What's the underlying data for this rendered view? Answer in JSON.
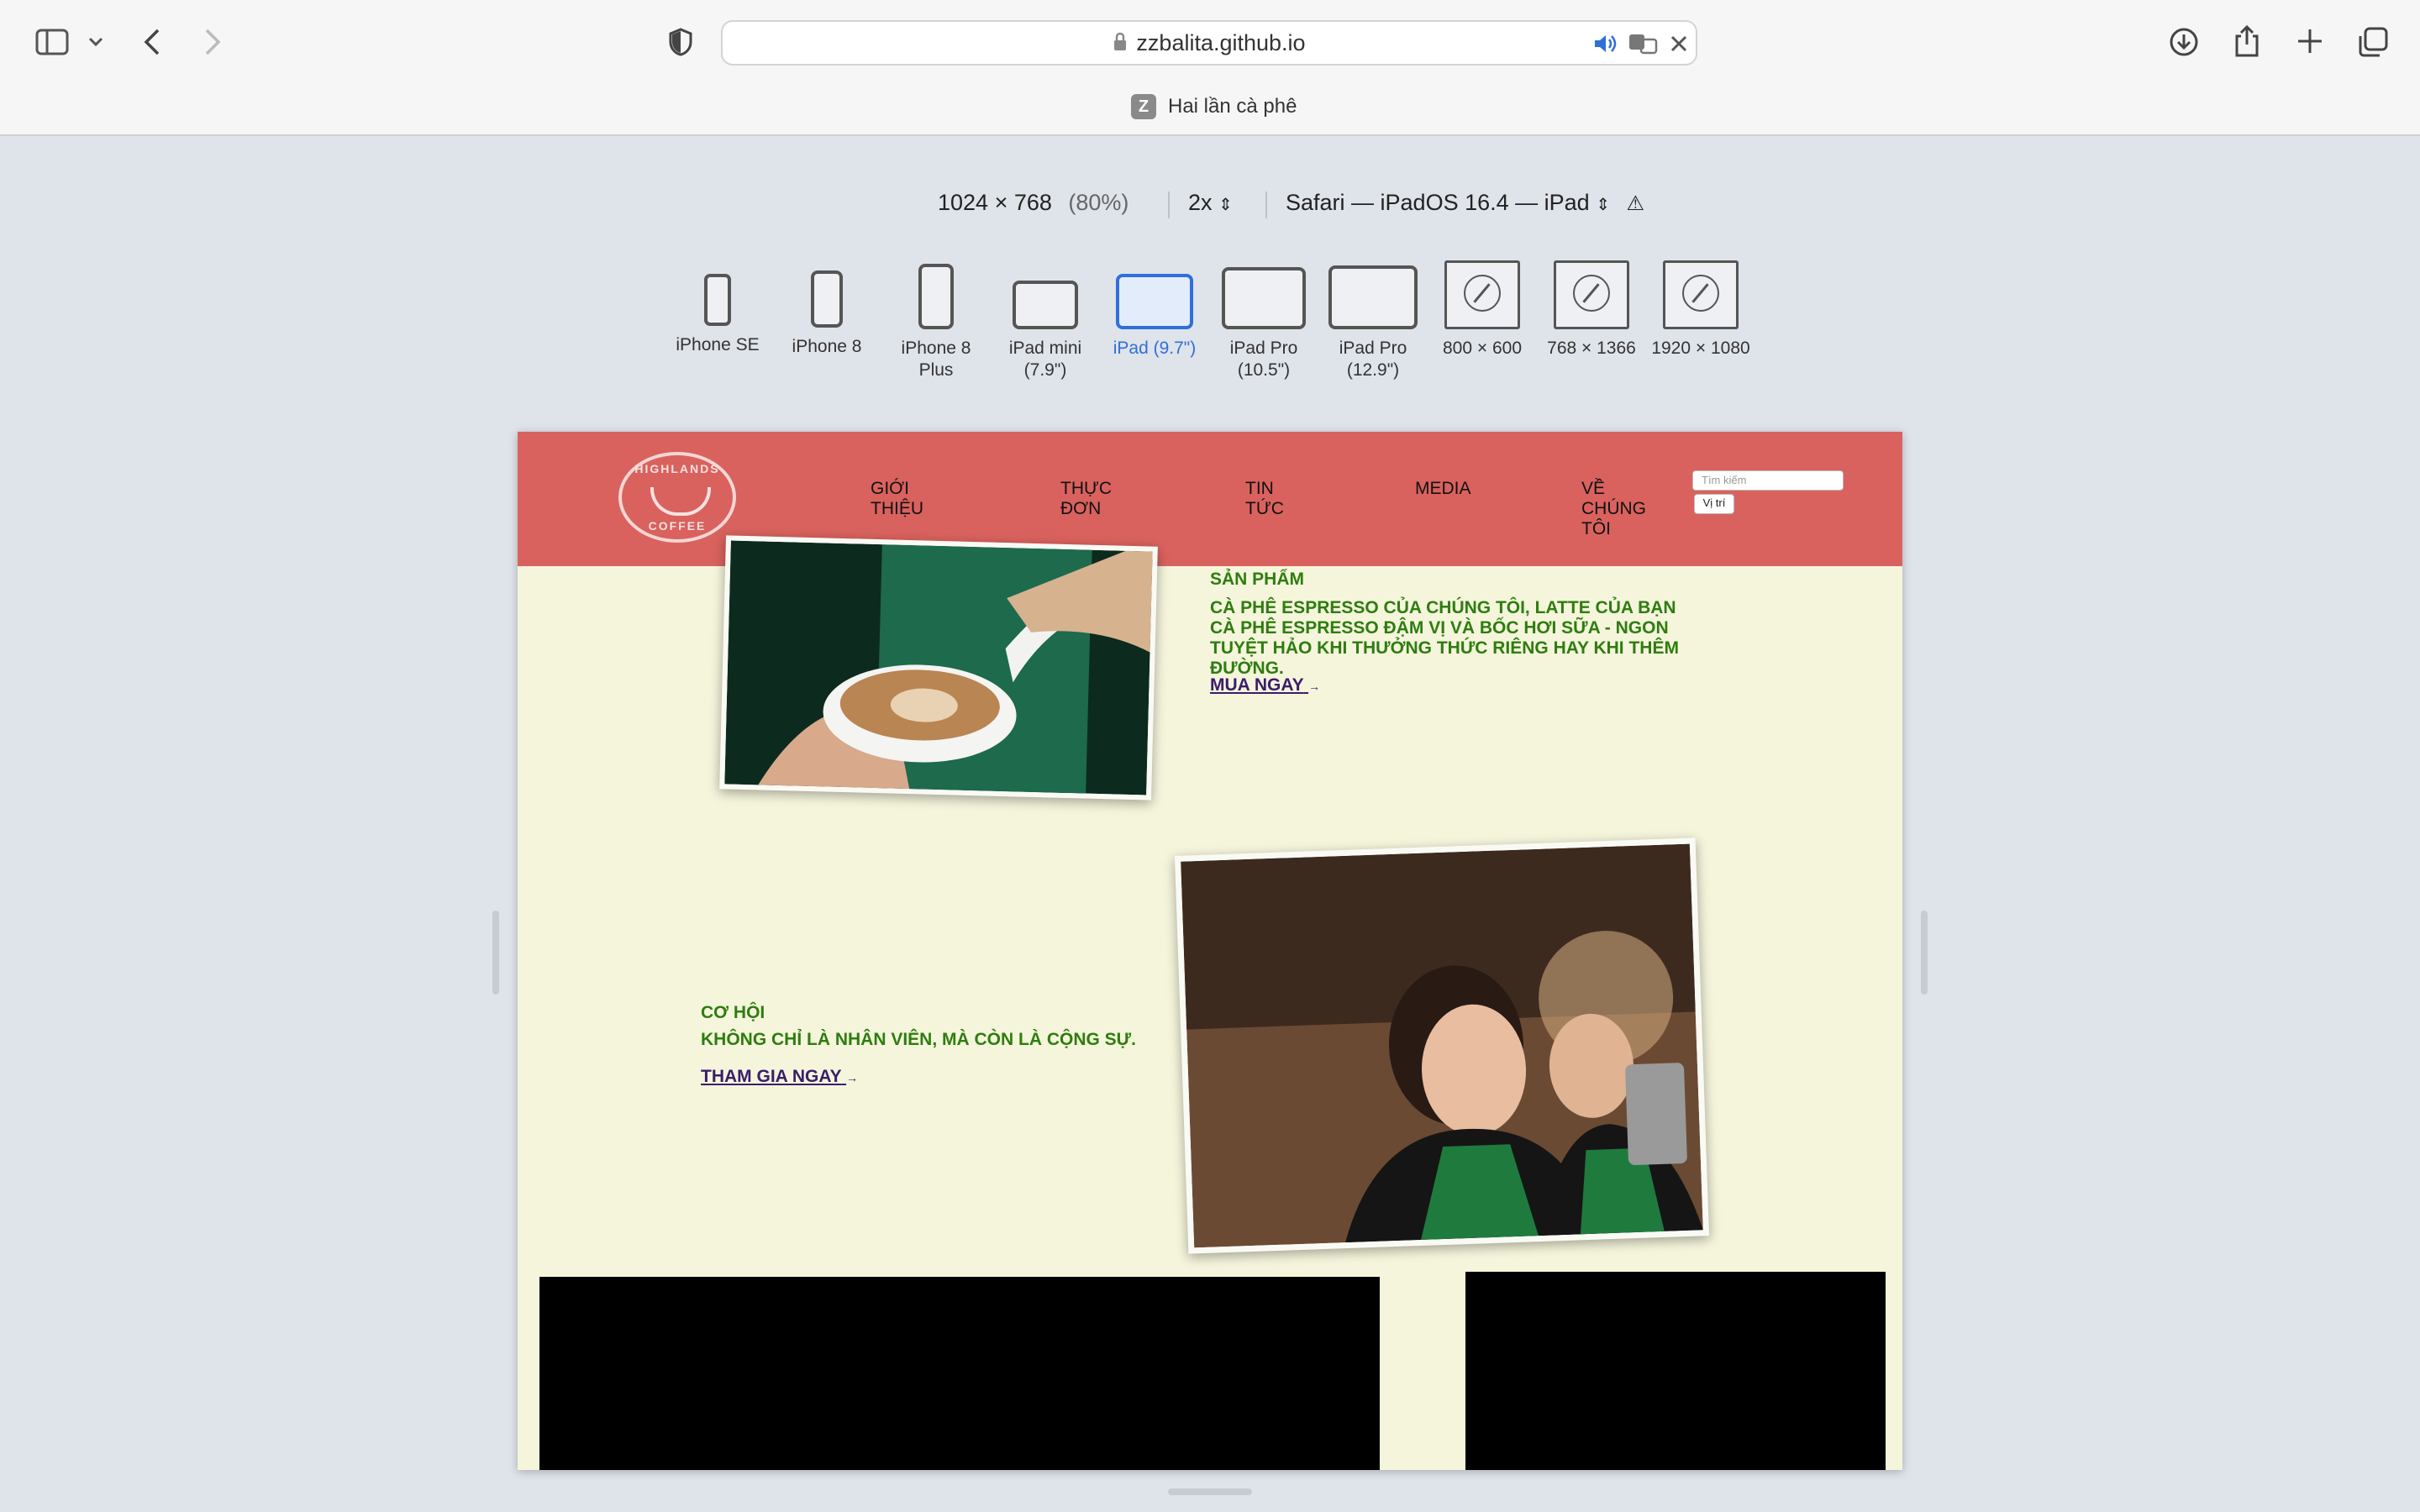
{
  "browser": {
    "url": "zzbalita.github.io",
    "tab_title": "Hai lần cà phê",
    "favicon_letter": "Z"
  },
  "responsive": {
    "size": "1024 × 768",
    "zoom": "(80%)",
    "scale": "2x",
    "agent": "Safari — iPadOS 16.4 — iPad",
    "devices": [
      {
        "label": "iPhone SE"
      },
      {
        "label": "iPhone 8"
      },
      {
        "label": "iPhone 8 Plus"
      },
      {
        "label": "iPad mini (7.9\")"
      },
      {
        "label": "iPad (9.7\")"
      },
      {
        "label": "iPad Pro (10.5\")"
      },
      {
        "label": "iPad Pro (12.9\")"
      },
      {
        "label": "800 × 600"
      },
      {
        "label": "768 × 1366"
      },
      {
        "label": "1920 × 1080"
      }
    ],
    "active_device_index": 4
  },
  "site": {
    "logo_top": "HIGHLANDS",
    "logo_bottom": "COFFEE",
    "nav": [
      {
        "label": "GIỚI THIỆU"
      },
      {
        "label": "THỰC ĐƠN"
      },
      {
        "label": "TIN TỨC"
      },
      {
        "label": "MEDIA"
      },
      {
        "label": "VỀ CHÚNG TÔI"
      }
    ],
    "search_placeholder": "Tìm kiếm",
    "location_button": "Vị trí",
    "product": {
      "heading": "SẢN PHẨM",
      "text": "CÀ PHÊ ESPRESSO CỦA CHÚNG TÔI, LATTE CỦA BẠN CÀ PHÊ ESPRESSO ĐẬM VỊ VÀ BỐC HƠI SỮA - NGON TUYỆT HẢO KHI THƯỞNG THỨC RIÊNG HAY KHI THÊM ĐƯỜNG.",
      "link": "MUA NGAY"
    },
    "career": {
      "heading": "CƠ HỘI",
      "text": "KHÔNG CHỈ LÀ NHÂN VIÊN, MÀ CÒN LÀ CỘNG SỰ.",
      "link": "THAM GIA NGAY"
    }
  }
}
